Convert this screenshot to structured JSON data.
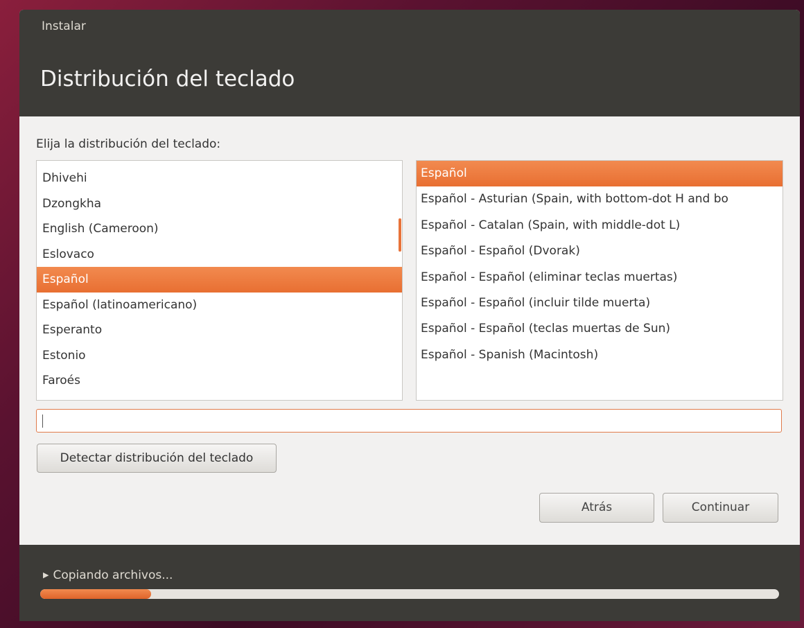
{
  "window": {
    "app_title": "Instalar",
    "page_title": "Distribución del teclado"
  },
  "main": {
    "prompt": "Elija la distribución del teclado:",
    "layouts": [
      {
        "label": "Dhivehi",
        "selected": false
      },
      {
        "label": "Dzongkha",
        "selected": false
      },
      {
        "label": "English (Cameroon)",
        "selected": false
      },
      {
        "label": "Eslovaco",
        "selected": false
      },
      {
        "label": "Español",
        "selected": true
      },
      {
        "label": "Español (latinoamericano)",
        "selected": false
      },
      {
        "label": "Esperanto",
        "selected": false
      },
      {
        "label": "Estonio",
        "selected": false
      },
      {
        "label": "Faroés",
        "selected": false
      }
    ],
    "variants": [
      {
        "label": "Español",
        "selected": true
      },
      {
        "label": "Español - Asturian (Spain, with bottom-dot H and bo",
        "selected": false
      },
      {
        "label": "Español - Catalan (Spain, with middle-dot L)",
        "selected": false
      },
      {
        "label": "Español - Español (Dvorak)",
        "selected": false
      },
      {
        "label": "Español - Español (eliminar teclas muertas)",
        "selected": false
      },
      {
        "label": "Español - Español (incluir tilde muerta)",
        "selected": false
      },
      {
        "label": "Español - Español (teclas muertas de Sun)",
        "selected": false
      },
      {
        "label": "Español - Spanish (Macintosh)",
        "selected": false
      }
    ],
    "test_input_value": "",
    "detect_button": "Detectar distribución del teclado",
    "back_button": "Atrás",
    "continue_button": "Continuar"
  },
  "footer": {
    "status_text": "Copiando archivos...",
    "progress": 0.15
  },
  "colors": {
    "accent": "#e8733a",
    "header_bg": "#3c3b37"
  }
}
